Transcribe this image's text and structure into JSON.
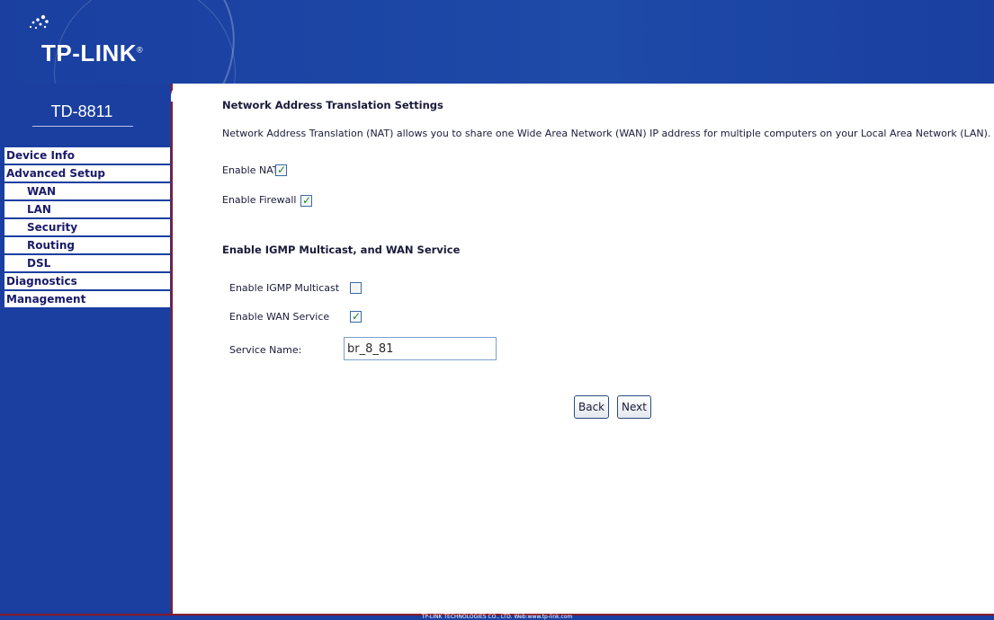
{
  "brand": {
    "logo_text": "TP-LINK",
    "trademark": "®",
    "model": "TD-8811"
  },
  "menu": [
    {
      "label": "Device Info",
      "sub": false
    },
    {
      "label": "Advanced Setup",
      "sub": false
    },
    {
      "label": "WAN",
      "sub": true
    },
    {
      "label": "LAN",
      "sub": true
    },
    {
      "label": "Security",
      "sub": true
    },
    {
      "label": "Routing",
      "sub": true
    },
    {
      "label": "DSL",
      "sub": true
    },
    {
      "label": "Diagnostics",
      "sub": false
    },
    {
      "label": "Management",
      "sub": false
    }
  ],
  "main": {
    "title": "Network Address Translation Settings",
    "description": "Network Address Translation (NAT) allows you to share one Wide Area Network (WAN) IP address for multiple computers on your Local Area Network (LAN).",
    "enable_nat_label": "Enable NAT",
    "enable_nat_checked": true,
    "enable_firewall_label": "Enable Firewall",
    "enable_firewall_checked": true,
    "section2_title": "Enable IGMP Multicast, and WAN Service",
    "enable_igmp_label": "Enable IGMP Multicast",
    "enable_igmp_checked": false,
    "enable_wan_label": "Enable WAN Service",
    "enable_wan_checked": true,
    "service_name_label": "Service Name:",
    "service_name_value": "br_8_81",
    "back_label": "Back",
    "next_label": "Next"
  },
  "footer": {
    "text": "TP-LINK TECHNOLOGIES CO., LTD. Web:www.tp-link.com"
  },
  "colors": {
    "banner": "#1a3fa0",
    "divider": "#8a1a2a",
    "check": "#1a8a1a"
  }
}
